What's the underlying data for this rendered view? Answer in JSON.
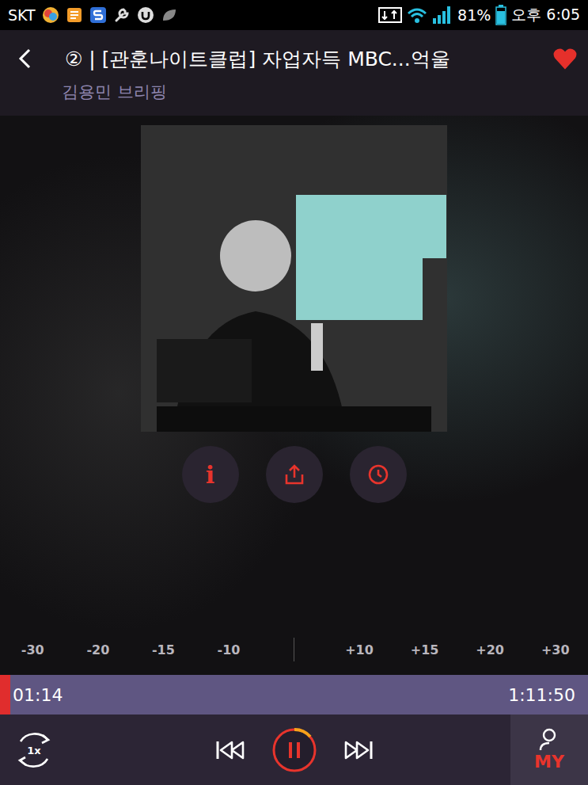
{
  "status_bar": {
    "carrier": "SKT",
    "battery": "81%",
    "battery_level": 0.81,
    "time": "오후 6:05"
  },
  "header": {
    "title": "② | [관훈나이트클럽] 자업자득 MBC...억울",
    "favorite": true,
    "subtitle": "김용민 브리핑"
  },
  "actions": {
    "info_label": "i"
  },
  "skip_buttons": [
    "-30",
    "-20",
    "-15",
    "-10",
    "+10",
    "+15",
    "+20",
    "+30"
  ],
  "progress": {
    "elapsed": "01:14",
    "duration": "1:11:50",
    "level": 0.017
  },
  "controls": {
    "speed": "1x",
    "playing": true,
    "my_label": "MY"
  }
}
